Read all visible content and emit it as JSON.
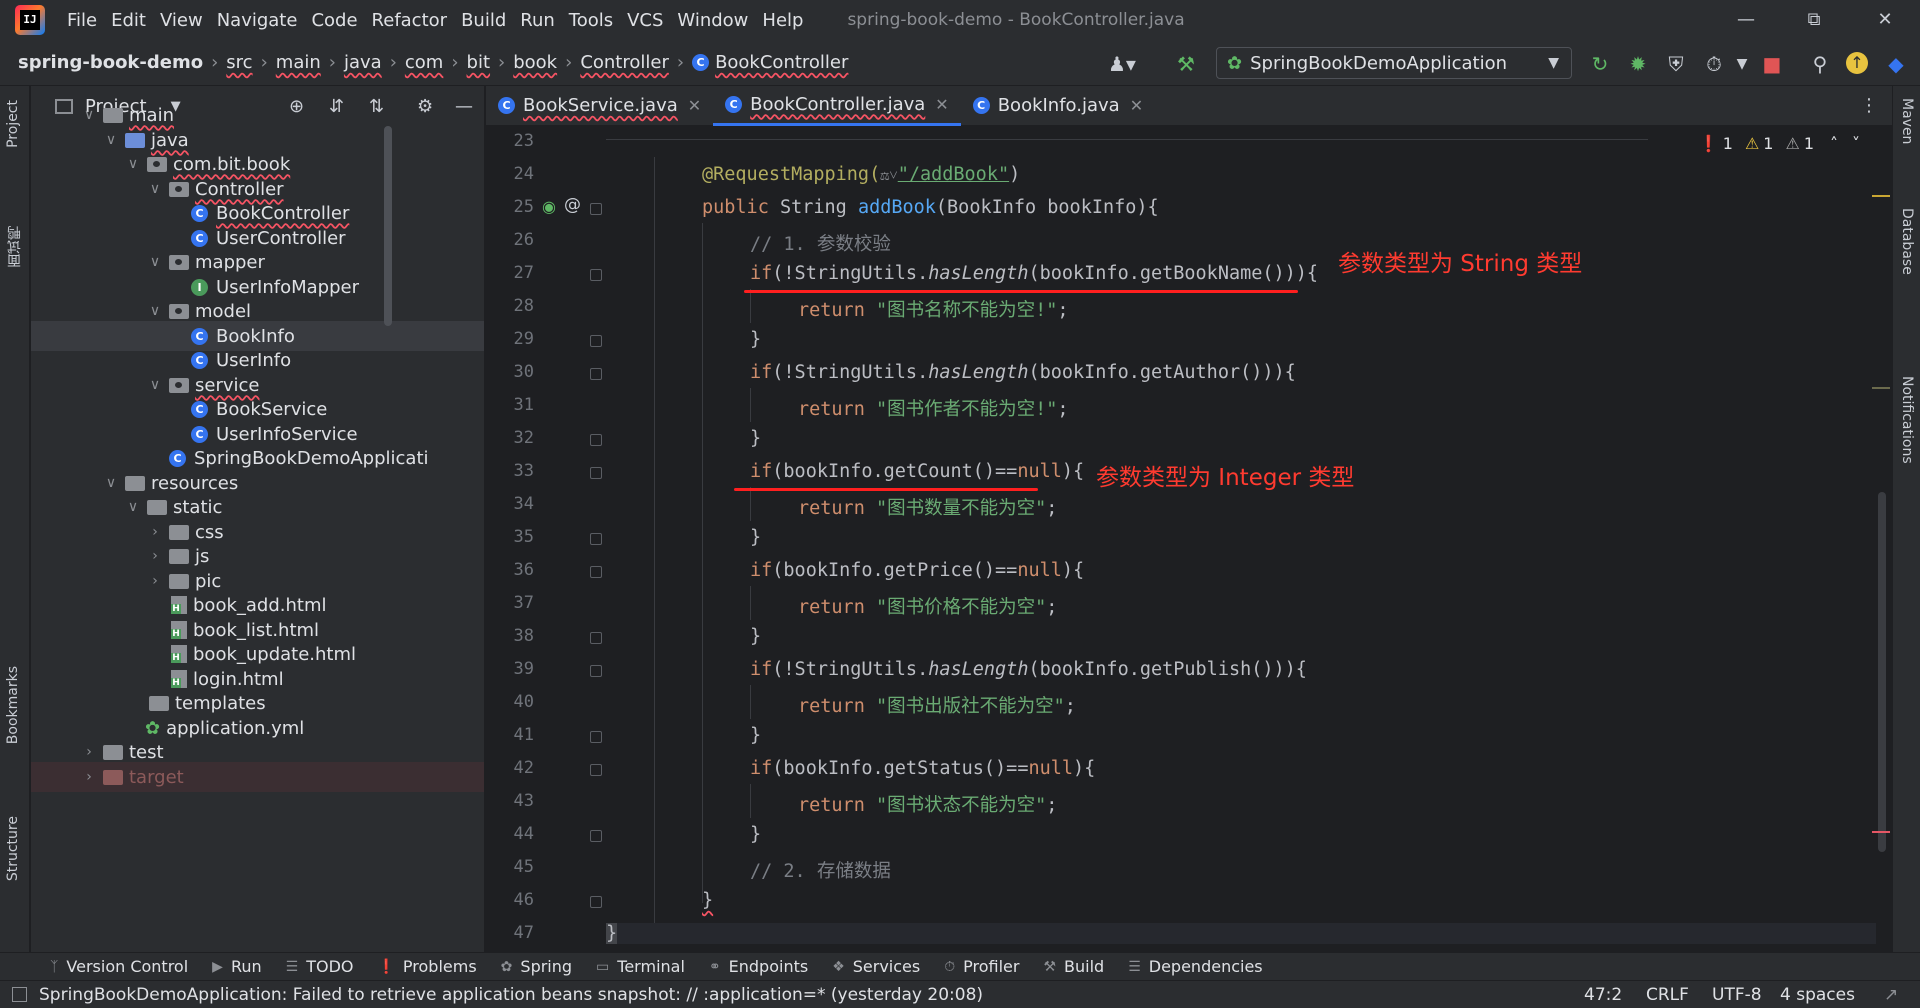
{
  "app": {
    "logo_text": "IJ",
    "window_title": "spring-book-demo - BookController.java"
  },
  "menu": [
    "File",
    "Edit",
    "View",
    "Navigate",
    "Code",
    "Refactor",
    "Build",
    "Run",
    "Tools",
    "VCS",
    "Window",
    "Help"
  ],
  "breadcrumbs": [
    "spring-book-demo",
    "src",
    "main",
    "java",
    "com",
    "bit",
    "book",
    "Controller",
    "BookController"
  ],
  "run_config": "SpringBookDemoApplication",
  "project_panel": {
    "title": "Project",
    "tree": [
      {
        "label": "main",
        "kind": "folder"
      },
      {
        "label": "java",
        "kind": "src"
      },
      {
        "label": "com.bit.book",
        "kind": "pkg"
      },
      {
        "label": "Controller",
        "kind": "pkg"
      },
      {
        "label": "BookController",
        "kind": "class"
      },
      {
        "label": "UserController",
        "kind": "class"
      },
      {
        "label": "mapper",
        "kind": "pkg"
      },
      {
        "label": "UserInfoMapper",
        "kind": "interface"
      },
      {
        "label": "model",
        "kind": "pkg"
      },
      {
        "label": "BookInfo",
        "kind": "class"
      },
      {
        "label": "UserInfo",
        "kind": "class"
      },
      {
        "label": "service",
        "kind": "pkg"
      },
      {
        "label": "BookService",
        "kind": "class"
      },
      {
        "label": "UserInfoService",
        "kind": "class"
      },
      {
        "label": "SpringBookDemoApplicati",
        "kind": "app"
      },
      {
        "label": "resources",
        "kind": "folder"
      },
      {
        "label": "static",
        "kind": "folder"
      },
      {
        "label": "css",
        "kind": "folder"
      },
      {
        "label": "js",
        "kind": "folder"
      },
      {
        "label": "pic",
        "kind": "folder"
      },
      {
        "label": "book_add.html",
        "kind": "html"
      },
      {
        "label": "book_list.html",
        "kind": "html"
      },
      {
        "label": "book_update.html",
        "kind": "html"
      },
      {
        "label": "login.html",
        "kind": "html"
      },
      {
        "label": "templates",
        "kind": "folder"
      },
      {
        "label": "application.yml",
        "kind": "yml"
      },
      {
        "label": "test",
        "kind": "folder"
      },
      {
        "label": "target",
        "kind": "folder"
      }
    ]
  },
  "tabs": [
    {
      "label": "BookService.java",
      "active": false
    },
    {
      "label": "BookController.java",
      "active": true
    },
    {
      "label": "BookInfo.java",
      "active": false
    }
  ],
  "inspections": {
    "errors": "1",
    "warnings": "1",
    "weak_warnings": "1"
  },
  "editor": {
    "line_numbers": [
      "23",
      "24",
      "25",
      "26",
      "27",
      "28",
      "29",
      "30",
      "31",
      "32",
      "33",
      "34",
      "35",
      "36",
      "37",
      "38",
      "39",
      "40",
      "41",
      "42",
      "43",
      "44",
      "45",
      "46",
      "47"
    ],
    "lines": {
      "l24_a": "@RequestMapping(",
      "l24_b": "\"/addBook\"",
      "l24_c": ")",
      "l25_a": "public",
      "l25_b": " String ",
      "l25_c": "addBook",
      "l25_d": "(BookInfo bookInfo){",
      "l26": "// 1. 参数校验",
      "l27_a": "if",
      "l27_b": "(!StringUtils.",
      "l27_c": "hasLength",
      "l27_d": "(bookInfo.getBookName())){",
      "l28_a": "return",
      "l28_b": " \"图书名称不能为空!\"",
      "l28_c": ";",
      "l29": "}",
      "l30_a": "if",
      "l30_b": "(!StringUtils.",
      "l30_c": "hasLength",
      "l30_d": "(bookInfo.getAuthor())){",
      "l31_a": "return",
      "l31_b": " \"图书作者不能为空!\"",
      "l31_c": ";",
      "l32": "}",
      "l33_a": "if",
      "l33_b": "(bookInfo.getCount()==",
      "l33_c": "null",
      "l33_d": "){",
      "l34_a": "return",
      "l34_b": " \"图书数量不能为空\"",
      "l34_c": ";",
      "l35": "}",
      "l36_a": "if",
      "l36_b": "(bookInfo.getPrice()==",
      "l36_c": "null",
      "l36_d": "){",
      "l37_a": "return",
      "l37_b": " \"图书价格不能为空\"",
      "l37_c": ";",
      "l38": "}",
      "l39_a": "if",
      "l39_b": "(!StringUtils.",
      "l39_c": "hasLength",
      "l39_d": "(bookInfo.getPublish())){",
      "l40_a": "return",
      "l40_b": " \"图书出版社不能为空\"",
      "l40_c": ";",
      "l41": "}",
      "l42_a": "if",
      "l42_b": "(bookInfo.getStatus()==",
      "l42_c": "null",
      "l42_d": "){",
      "l43_a": "return",
      "l43_b": " \"图书状态不能为空\"",
      "l43_c": ";",
      "l44": "}",
      "l45": "// 2. 存储数据",
      "l46": "}",
      "l47": "}"
    },
    "annotations": {
      "string_note": "参数类型为 String 类型",
      "integer_note": "参数类型为 Integer 类型"
    }
  },
  "left_strip": {
    "project": "Project",
    "cn": "面试鸭",
    "bookmarks": "Bookmarks",
    "structure": "Structure"
  },
  "right_strip": {
    "maven": "Maven",
    "database": "Database",
    "notifications": "Notifications"
  },
  "tool_windows": [
    "Version Control",
    "Run",
    "TODO",
    "Problems",
    "Spring",
    "Terminal",
    "Endpoints",
    "Services",
    "Profiler",
    "Build",
    "Dependencies"
  ],
  "status": {
    "message": "SpringBookDemoApplication: Failed to retrieve application beans snapshot: // :application=* (yesterday 20:08)",
    "position": "47:2",
    "line_sep": "CRLF",
    "encoding": "UTF-8",
    "indent": "4 spaces"
  },
  "colors": {
    "accent": "#3574f0",
    "annotation_red": "#ff1f1f",
    "background": "#1e1f22",
    "panel": "#2b2d30"
  }
}
